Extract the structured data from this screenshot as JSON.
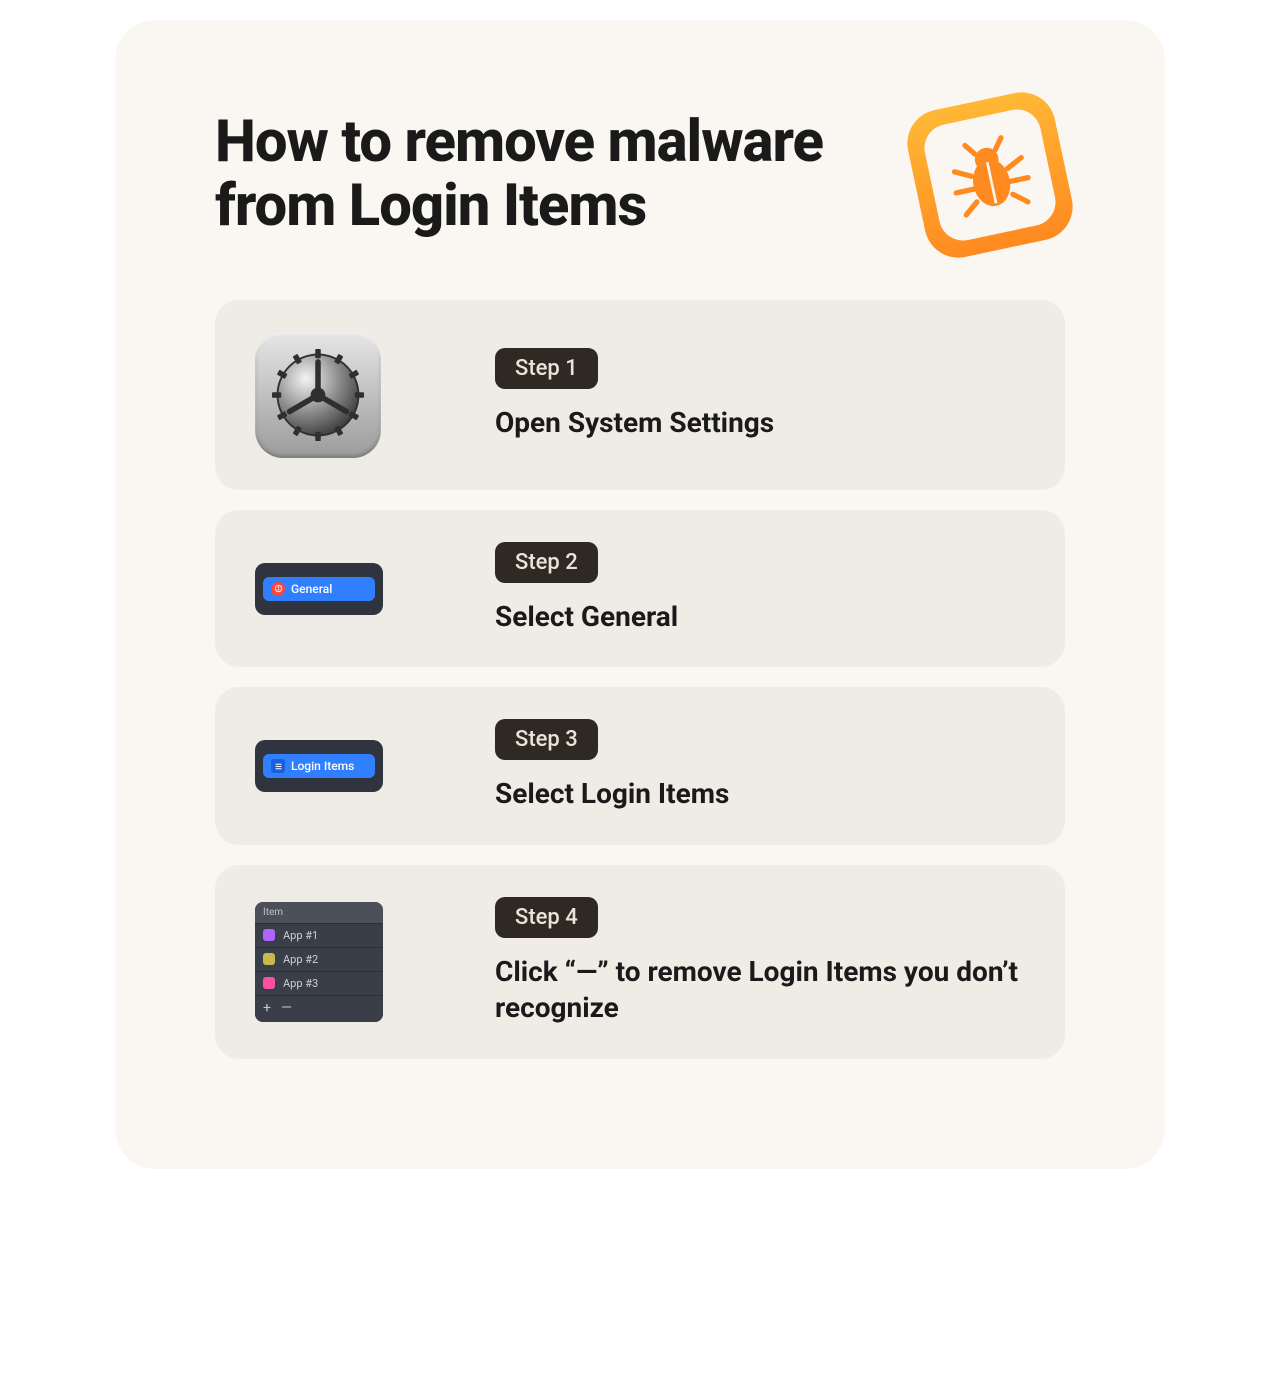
{
  "title": "How to remove malware from Login Items",
  "steps": [
    {
      "badge": "Step 1",
      "desc": "Open System Settings"
    },
    {
      "badge": "Step 2",
      "desc": "Select General",
      "row_label": "General"
    },
    {
      "badge": "Step 3",
      "desc": "Select Login Items",
      "row_label": "Login Items"
    },
    {
      "badge": "Step 4",
      "desc": "Click “—” to remove Login Items you don’t recognize",
      "list_header": "Item",
      "apps": [
        "App #1",
        "App #2",
        "App #3"
      ],
      "add": "+",
      "remove": "—"
    }
  ]
}
